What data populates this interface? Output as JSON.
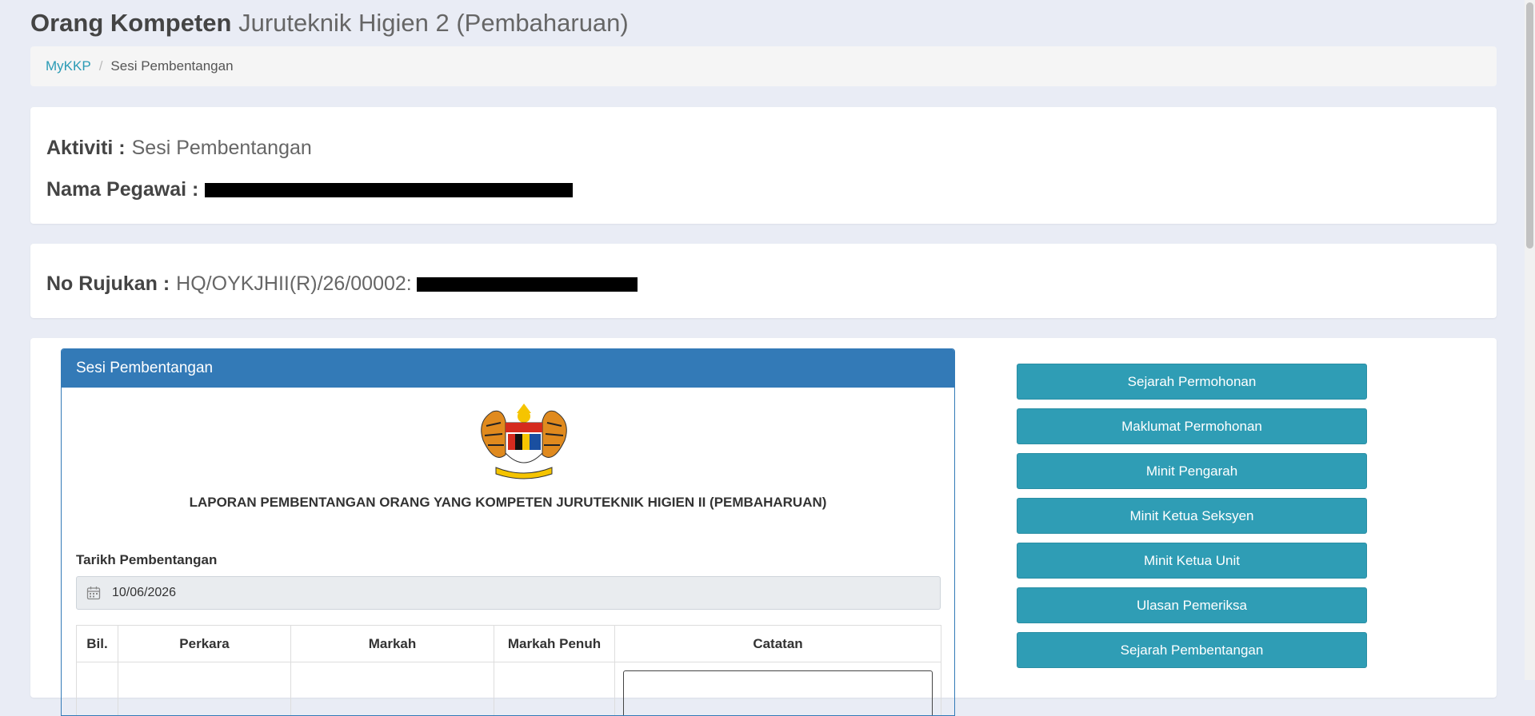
{
  "page": {
    "title_strong": "Orang Kompeten",
    "title_light": "Juruteknik Higien 2 (Pembaharuan)"
  },
  "breadcrumb": {
    "home": "MyKKP",
    "separator": "/",
    "current": "Sesi Pembentangan"
  },
  "info": {
    "activity_label": "Aktiviti :",
    "activity_value": "Sesi Pembentangan",
    "officer_label": "Nama Pegawai :",
    "reference_label": "No Rujukan :",
    "reference_value": "HQ/OYKJHII(R)/26/00002:"
  },
  "panel": {
    "heading": "Sesi Pembentangan",
    "report_title": "LAPORAN PEMBENTANGAN ORANG YANG KOMPETEN JURUTEKNIK HIGIEN II (PEMBAHARUAN)",
    "date_label": "Tarikh Pembentangan",
    "date_value": "10/06/2026",
    "table_headers": [
      "Bil.",
      "Perkara",
      "Markah",
      "Markah Penuh",
      "Catatan"
    ]
  },
  "actions": [
    "Sejarah Permohonan",
    "Maklumat Permohonan",
    "Minit Pengarah",
    "Minit Ketua Seksyen",
    "Minit Ketua Unit",
    "Ulasan Pemeriksa",
    "Sejarah Pembentangan"
  ],
  "colors": {
    "primary_panel": "#337ab7",
    "action_button": "#2f9db5",
    "link": "#2a9bb5",
    "background": "#e9ecf5"
  },
  "icons": {
    "date_icon": "calendar-icon",
    "emblem": "malaysia-coat-of-arms"
  }
}
